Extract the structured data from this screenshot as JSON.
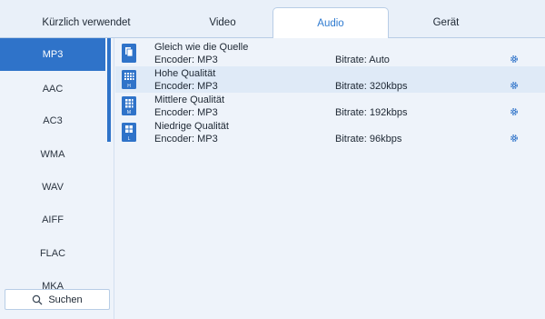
{
  "tabs": [
    {
      "label": "Kürzlich verwendet"
    },
    {
      "label": "Video"
    },
    {
      "label": "Audio",
      "active": true
    },
    {
      "label": "Gerät"
    }
  ],
  "sidebar": {
    "formats": [
      "MP3",
      "AAC",
      "AC3",
      "WMA",
      "WAV",
      "AIFF",
      "FLAC",
      "MKA"
    ],
    "selected": "MP3",
    "search_label": "Suchen"
  },
  "presets": [
    {
      "name": "Gleich wie die Quelle",
      "encoder": "Encoder: MP3",
      "bitrate": "Bitrate: Auto",
      "badge": "",
      "icon": "source-quality-icon"
    },
    {
      "name": "Hohe Qualität",
      "encoder": "Encoder: MP3",
      "bitrate": "Bitrate: 320kbps",
      "badge": "H",
      "icon": "high-quality-icon"
    },
    {
      "name": "Mittlere Qualität",
      "encoder": "Encoder: MP3",
      "bitrate": "Bitrate: 192kbps",
      "badge": "M",
      "icon": "medium-quality-icon"
    },
    {
      "name": "Niedrige Qualität",
      "encoder": "Encoder: MP3",
      "bitrate": "Bitrate: 96kbps",
      "badge": "L",
      "icon": "low-quality-icon"
    }
  ],
  "colors": {
    "accent": "#2f73c9",
    "tab_active_text": "#2f7bd0",
    "selected_row": "#dfeaf7",
    "background": "#eef3fa"
  }
}
